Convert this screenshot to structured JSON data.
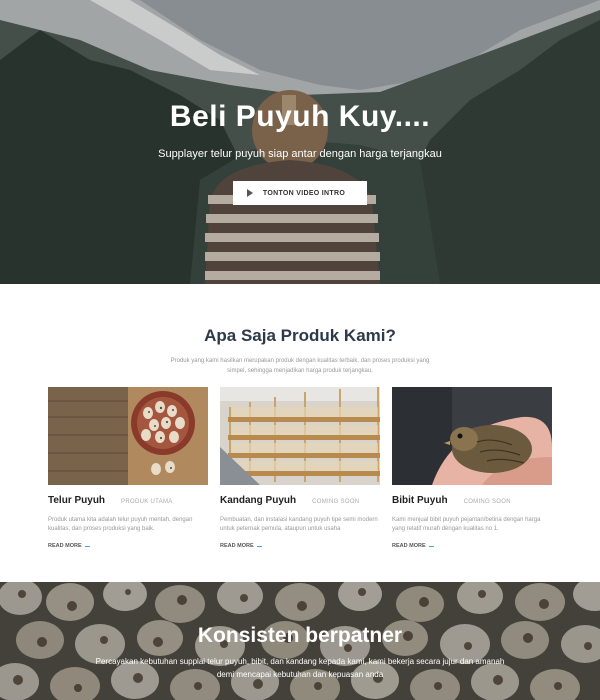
{
  "hero": {
    "title": "Beli Puyuh Kuy....",
    "subtitle": "Supplayer telur puyuh siap antar dengan harga terjangkau",
    "button_label": "TONTON VIDEO INTRO",
    "button_icon": "play-icon"
  },
  "products": {
    "title": "Apa Saja Produk Kami?",
    "description": "Produk yang kami hasilkan merupakan produk dengan kualitas terbaik, dan proses produksi yang simpel, sehingga menjadikan harga produk terjangkau.",
    "cards": [
      {
        "name": "Telur Puyuh",
        "tag": "PRODUK UTAMA",
        "description": "Produk utama kita adalah telur puyuh mentah, dengan kualitas, dan proses produksi yang baik.",
        "more": "READ MORE"
      },
      {
        "name": "Kandang Puyuh",
        "tag": "COMING SOON",
        "description": "Pembuatan, dan instalasi kandang puyuh tipe semi modern untuk peternak pemula, ataupun untuk usaha",
        "more": "READ MORE"
      },
      {
        "name": "Bibit Puyuh",
        "tag": "COMING SOON",
        "description": "Kami menjual bibit puyuh pejantan/betina dengan harga yang relatif murah dengan kualitas no 1.",
        "more": "READ MORE"
      }
    ]
  },
  "banner": {
    "title": "Konsisten berpatner",
    "text": "Percayakan kebutuhan supplai telur puyuh, bibit, dan kandang kepada kami, kami bekerja secara jujur dan amanah demi mencapai kebutuhan dan kepuasan anda"
  },
  "colors": {
    "heading": "#2d3a4a",
    "accent": "#4aa3d8"
  }
}
